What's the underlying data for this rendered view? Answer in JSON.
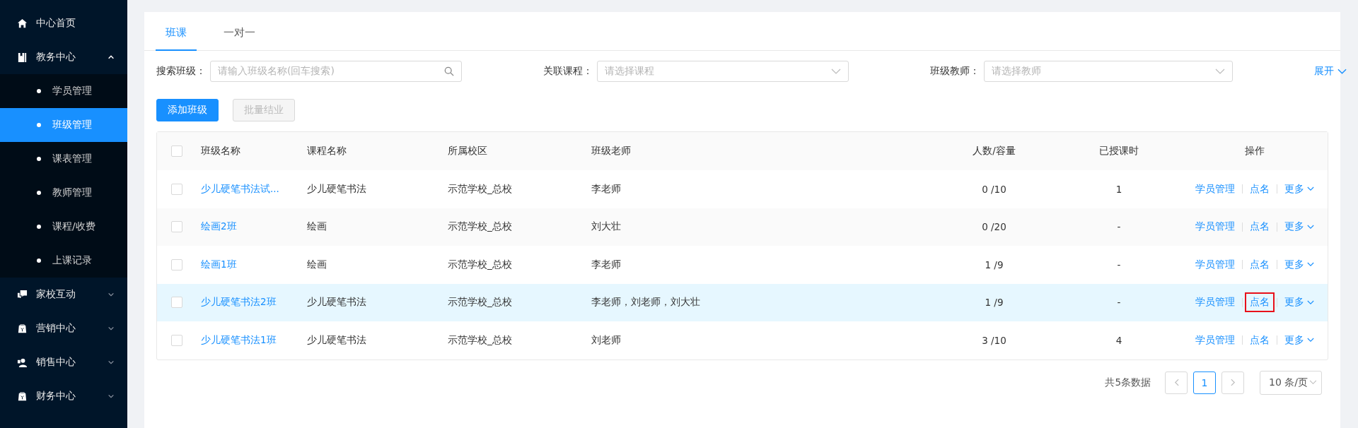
{
  "sidebar": {
    "items": [
      {
        "label": "中心首页",
        "selected": false
      },
      {
        "label": "教务中心",
        "selected": false,
        "expanded": true,
        "children": [
          {
            "label": "学员管理",
            "selected": false
          },
          {
            "label": "班级管理",
            "selected": true
          },
          {
            "label": "课表管理",
            "selected": false
          },
          {
            "label": "教师管理",
            "selected": false
          },
          {
            "label": "课程/收费",
            "selected": false
          },
          {
            "label": "上课记录",
            "selected": false
          }
        ]
      },
      {
        "label": "家校互动",
        "selected": false,
        "expanded": false
      },
      {
        "label": "营销中心",
        "selected": false,
        "expanded": false
      },
      {
        "label": "销售中心",
        "selected": false,
        "expanded": false
      },
      {
        "label": "财务中心",
        "selected": false,
        "expanded": false
      }
    ]
  },
  "tabs": [
    {
      "label": "班课",
      "selected": true
    },
    {
      "label": "一对一",
      "selected": false
    }
  ],
  "filters": [
    {
      "kind": "search",
      "label": "搜索班级：",
      "placeholder": "请输入班级名称(回车搜索)"
    },
    {
      "kind": "select",
      "label": "关联课程：",
      "placeholder": "请选择课程"
    },
    {
      "kind": "select",
      "label": "班级教师：",
      "placeholder": "请选择教师"
    }
  ],
  "expand_toggle": "展开",
  "buttons": [
    {
      "label": "添加班级",
      "disabled": false
    },
    {
      "label": "批量结业",
      "disabled": true
    }
  ],
  "table": {
    "select_all": {
      "checked": false
    },
    "columns": [
      "班级名称",
      "课程名称",
      "所属校区",
      "班级老师",
      "人数/容量",
      "已授课时",
      "操作"
    ],
    "rows": [
      {
        "checked": false,
        "highlighted": false,
        "name": "少儿硬笔书法试...",
        "course": "少儿硬笔书法",
        "campus": "示范学校_总校",
        "teacher": "李老师",
        "count": "0 /10",
        "hours": "1",
        "actions": [
          {
            "kind": "link",
            "label": "学员管理",
            "outlined": false
          },
          {
            "kind": "link",
            "label": "点名",
            "outlined": false
          },
          {
            "kind": "dropdown",
            "label": "更多",
            "outlined": false
          }
        ]
      },
      {
        "checked": false,
        "highlighted": false,
        "name": "绘画2班",
        "course": "绘画",
        "campus": "示范学校_总校",
        "teacher": "刘大壮",
        "count": "0 /20",
        "hours": "-",
        "actions": [
          {
            "kind": "link",
            "label": "学员管理",
            "outlined": false
          },
          {
            "kind": "link",
            "label": "点名",
            "outlined": false
          },
          {
            "kind": "dropdown",
            "label": "更多",
            "outlined": false
          }
        ]
      },
      {
        "checked": false,
        "highlighted": false,
        "name": "绘画1班",
        "course": "绘画",
        "campus": "示范学校_总校",
        "teacher": "李老师",
        "count": "1 /9",
        "hours": "-",
        "actions": [
          {
            "kind": "link",
            "label": "学员管理",
            "outlined": false
          },
          {
            "kind": "link",
            "label": "点名",
            "outlined": false
          },
          {
            "kind": "dropdown",
            "label": "更多",
            "outlined": false
          }
        ]
      },
      {
        "checked": false,
        "highlighted": true,
        "name": "少儿硬笔书法2班",
        "course": "少儿硬笔书法",
        "campus": "示范学校_总校",
        "teacher": "李老师，刘老师，刘大壮",
        "count": "1 /9",
        "hours": "-",
        "actions": [
          {
            "kind": "link",
            "label": "学员管理",
            "outlined": false
          },
          {
            "kind": "link",
            "label": "点名",
            "outlined": true
          },
          {
            "kind": "dropdown",
            "label": "更多",
            "outlined": false
          }
        ]
      },
      {
        "checked": false,
        "highlighted": false,
        "name": "少儿硬笔书法1班",
        "course": "少儿硬笔书法",
        "campus": "示范学校_总校",
        "teacher": "刘老师",
        "count": "3 /10",
        "hours": "4",
        "actions": [
          {
            "kind": "link",
            "label": "学员管理",
            "outlined": false
          },
          {
            "kind": "link",
            "label": "点名",
            "outlined": false
          },
          {
            "kind": "dropdown",
            "label": "更多",
            "outlined": false
          }
        ]
      }
    ]
  },
  "pagination": {
    "total": "共5条数据",
    "pages": [
      {
        "label": "1",
        "selected": true
      }
    ],
    "page_size": "10 条/页"
  }
}
